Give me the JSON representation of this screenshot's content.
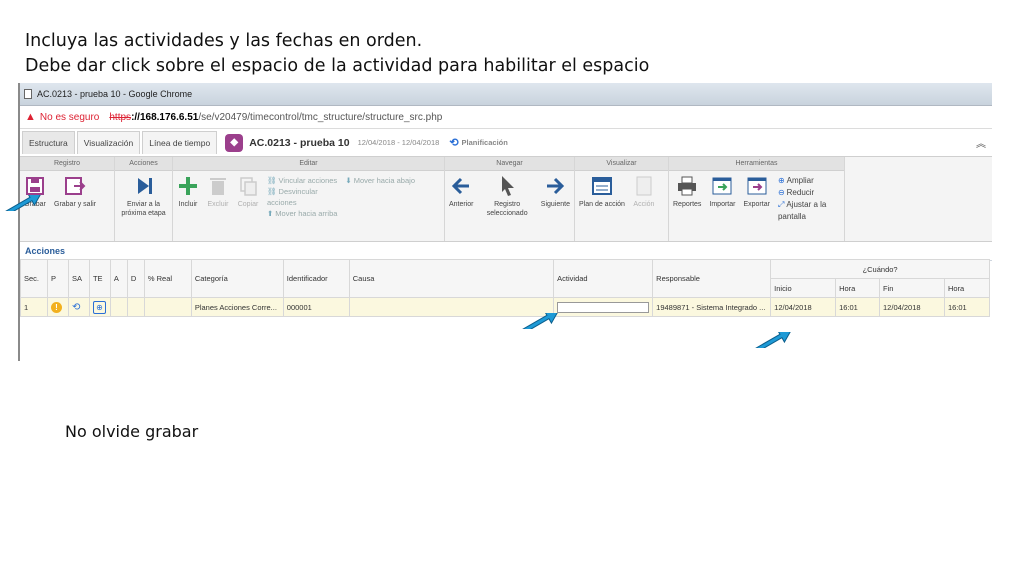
{
  "instructions": {
    "line1": "Incluya las actividades y las fechas en orden.",
    "line2": "Debe dar click sobre el espacio de la actividad para habilitar el espacio",
    "footer_note": "No olvide grabar"
  },
  "browser": {
    "window_title": "AC.0213 - prueba 10 - Google Chrome",
    "security_label": "No es seguro",
    "url_scheme": "https",
    "url_host": "://168.176.6.51",
    "url_path": "/se/v20479/timecontrol/tmc_structure/structure_src.php"
  },
  "app": {
    "tabs": [
      "Estructura",
      "Visualización",
      "Línea de tiempo"
    ],
    "title": "AC.0213 - prueba 10",
    "dates": "12/04/2018 - 12/04/2018",
    "planificacion": "Planificación"
  },
  "ribbon": {
    "registro": {
      "header": "Registro",
      "grabar": "Grabar",
      "grabar_salir": "Grabar y salir"
    },
    "acciones": {
      "header": "Acciones",
      "enviar": "Enviar a la próxima etapa"
    },
    "editar": {
      "header": "Editar",
      "incluir": "Incluir",
      "excluir": "Excluir",
      "copiar": "Copiar",
      "vincular": "Vincular acciones",
      "desvincular": "Desvincular acciones",
      "mover_abajo": "Mover hacia abajo",
      "mover_arriba": "Mover hacia arriba"
    },
    "navegar": {
      "header": "Navegar",
      "anterior": "Anterior",
      "registro_sel": "Registro seleccionado",
      "siguiente": "Siguiente"
    },
    "visualizar": {
      "header": "Visualizar",
      "plan": "Plan de acción",
      "accion": "Acción"
    },
    "herramientas": {
      "header": "Herramientas",
      "reportes": "Reportes",
      "importar": "Importar",
      "exportar": "Exportar",
      "ampliar": "Ampliar",
      "reducir": "Reducir",
      "ajustar": "Ajustar a la pantalla"
    }
  },
  "section_title": "Acciones",
  "table": {
    "headers": {
      "sec": "Sec.",
      "p": "P",
      "sa": "SA",
      "te": "TE",
      "a": "A",
      "d": "D",
      "real": "% Real",
      "categoria": "Categoría",
      "identificador": "Identificador",
      "causa": "Causa",
      "actividad": "Actividad",
      "responsable": "Responsable",
      "cuando": "¿Cuándo?",
      "inicio": "Inicio",
      "hora1": "Hora",
      "fin": "Fin",
      "hora2": "Hora"
    },
    "row": {
      "sec": "1",
      "categoria": "Planes Acciones Corre...",
      "identificador": "000001",
      "responsable": "19489871 - Sistema Integrado ...",
      "inicio": "12/04/2018",
      "hora1": "16:01",
      "fin": "12/04/2018",
      "hora2": "16:01"
    }
  },
  "colors": {
    "arrow": "#1e9ad6",
    "brand": "#9b3f8c",
    "accent": "#2a6fd6"
  }
}
